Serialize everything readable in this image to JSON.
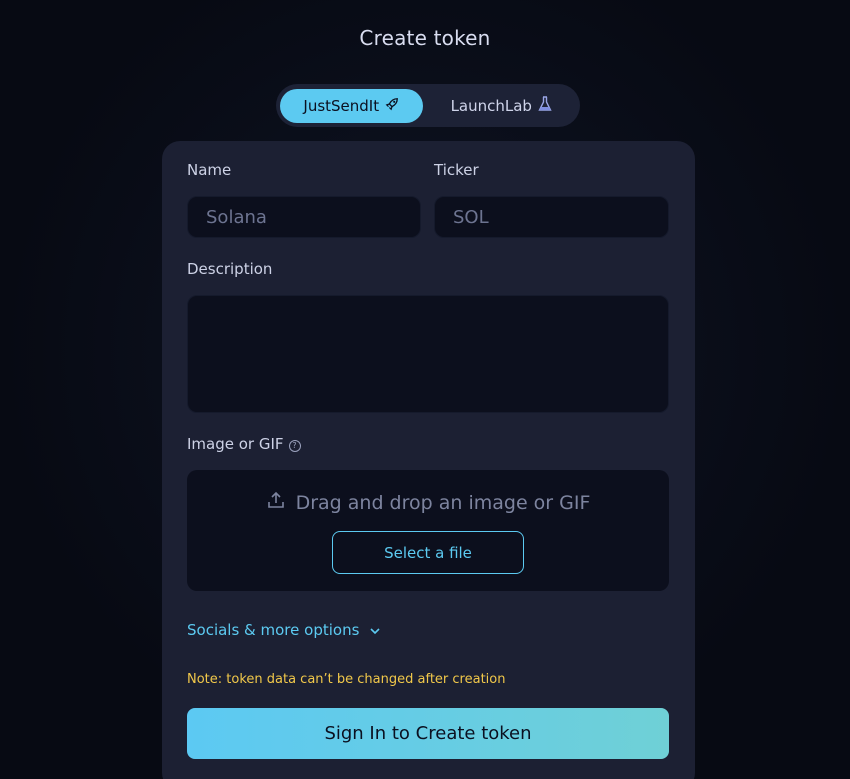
{
  "header": {
    "title": "Create token"
  },
  "launch_toggle": {
    "options": [
      {
        "label": "JustSendIt",
        "icon": "rocket-icon",
        "active": true
      },
      {
        "label": "LaunchLab",
        "icon": "flask-icon",
        "active": false
      }
    ]
  },
  "form": {
    "name": {
      "label": "Name",
      "placeholder": "Solana",
      "value": ""
    },
    "ticker": {
      "label": "Ticker",
      "placeholder": "SOL",
      "value": ""
    },
    "description": {
      "label": "Description",
      "value": ""
    },
    "image": {
      "label": "Image or GIF",
      "help_icon": "question-circle-icon",
      "drop_text": "Drag and drop an image or GIF",
      "upload_icon": "upload-icon",
      "select_button": "Select a file"
    },
    "socials_toggle": {
      "label": "Socials & more options",
      "icon": "chevron-down-icon"
    },
    "note": "Note: token data can’t be changed after creation",
    "submit_label": "Sign In to Create token"
  },
  "colors": {
    "accent": "#5ccaf1",
    "note": "#f1c84a",
    "card": "#1c2033",
    "input": "#0c0f1d",
    "background": "#070a13"
  }
}
